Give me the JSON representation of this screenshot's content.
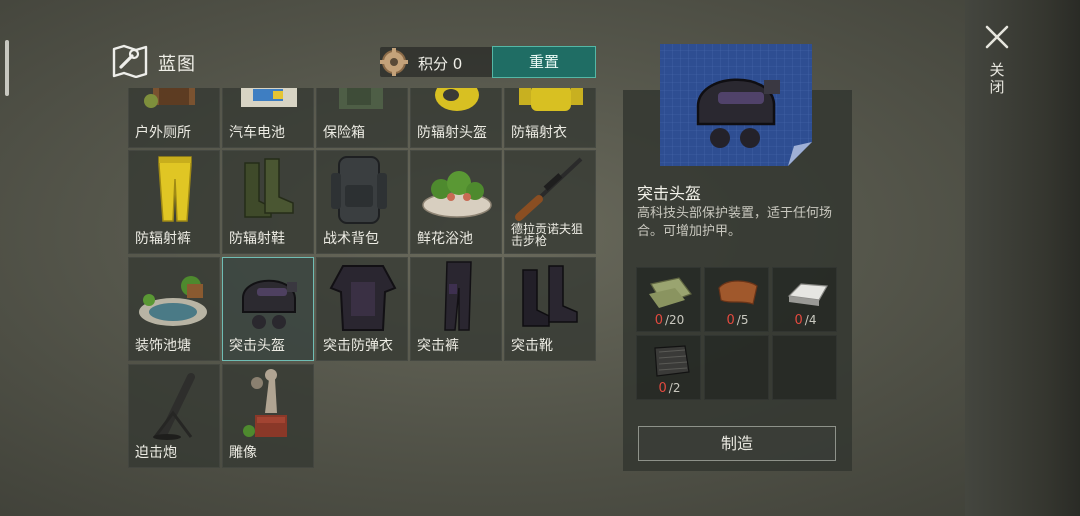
{
  "header": {
    "title": "蓝图",
    "points_label": "积分 0",
    "reset_label": "重置"
  },
  "grid": {
    "items": [
      {
        "name": "户外厕所",
        "icon": "outhouse-icon"
      },
      {
        "name": "汽车电池",
        "icon": "car-battery-icon"
      },
      {
        "name": "保险箱",
        "icon": "safe-icon"
      },
      {
        "name": "防辐射头盔",
        "icon": "hazmat-helmet-icon"
      },
      {
        "name": "防辐射衣",
        "icon": "hazmat-suit-icon"
      },
      {
        "name": "防辐射裤",
        "icon": "hazmat-pants-icon"
      },
      {
        "name": "防辐射鞋",
        "icon": "rubber-boots-icon"
      },
      {
        "name": "战术背包",
        "icon": "tactical-backpack-icon"
      },
      {
        "name": "鲜花浴池",
        "icon": "flower-bath-icon"
      },
      {
        "name": "德拉贡诺夫狙击步枪",
        "icon": "sniper-rifle-icon"
      },
      {
        "name": "装饰池塘",
        "icon": "pond-icon"
      },
      {
        "name": "突击头盔",
        "icon": "assault-helmet-icon"
      },
      {
        "name": "突击防弹衣",
        "icon": "assault-vest-icon"
      },
      {
        "name": "突击裤",
        "icon": "assault-pants-icon"
      },
      {
        "name": "突击靴",
        "icon": "assault-boots-icon"
      },
      {
        "name": "迫击炮",
        "icon": "mortar-icon"
      },
      {
        "name": "雕像",
        "icon": "statue-icon"
      }
    ]
  },
  "detail": {
    "title": "突击头盔",
    "description": "高科技头部保护装置，适于任何场合。可增加护甲。",
    "materials": [
      {
        "icon": "cloth-icon",
        "have": "0",
        "need": "/20"
      },
      {
        "icon": "leather-icon",
        "have": "0",
        "need": "/5"
      },
      {
        "icon": "metal-ingot-icon",
        "have": "0",
        "need": "/4"
      },
      {
        "icon": "kevlar-sheet-icon",
        "have": "0",
        "need": "/2"
      }
    ],
    "craft_label": "制造"
  },
  "close_label": "关闭",
  "colors": {
    "accent": "#1f6d64",
    "accent_border": "#54b7a6",
    "missing": "#e34a3f"
  }
}
